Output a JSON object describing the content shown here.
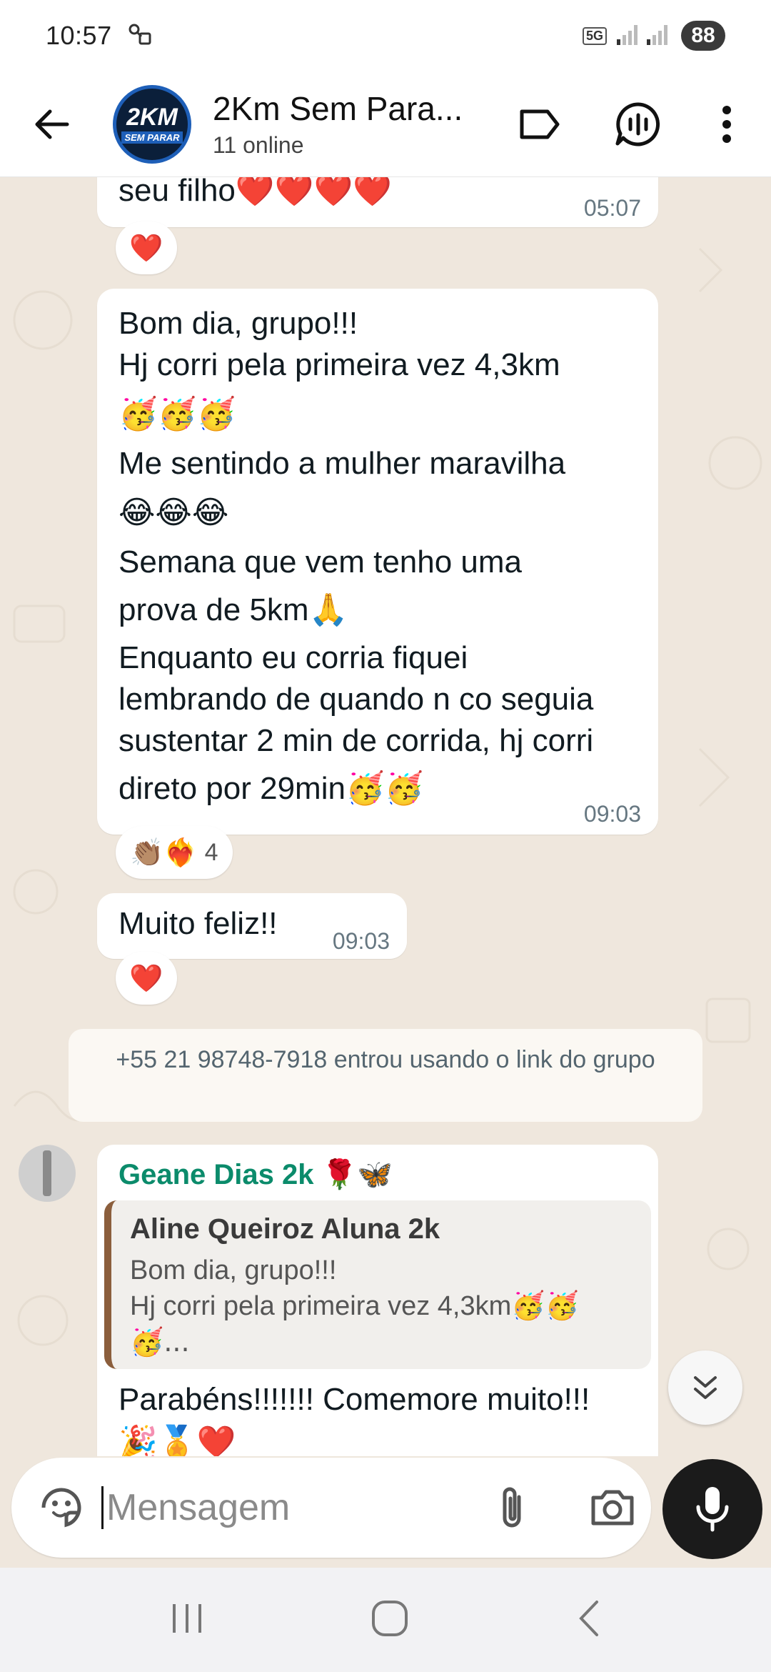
{
  "status_bar": {
    "time": "10:57",
    "network": "5G",
    "battery": "88"
  },
  "header": {
    "avatar_line1": "2KM",
    "avatar_line2": "SEM PARAR",
    "title": "2Km Sem Para...",
    "subtitle": "11 online"
  },
  "messages": [
    {
      "text": "seu filho❤️❤️❤️❤️",
      "time": "05:07",
      "reaction": "❤️"
    },
    {
      "lines": [
        "Bom dia, grupo!!!",
        "Hj corri pela primeira vez 4,3km",
        "🥳🥳🥳",
        "Me sentindo a mulher maravilha",
        "😂😂😂",
        "Semana que vem tenho uma",
        "prova de 5km🙏",
        "Enquanto eu corria fiquei",
        "lembrando de quando n co seguia",
        "sustentar 2 min de corrida, hj corri",
        "direto por 29min🥳🥳"
      ],
      "time": "09:03",
      "reactions": "👏🏽❤️‍🔥",
      "reaction_count": "4"
    },
    {
      "text": "Muito feliz!!",
      "time": "09:03",
      "reaction": "❤️"
    }
  ],
  "system_message": "+55 21 98748-7918 entrou usando o link do grupo",
  "reply_message": {
    "sender": "Geane Dias 2k 🌹🦋",
    "quoted_name": "Aline Queiroz Aluna 2k",
    "quoted_line1": "Bom dia, grupo!!!",
    "quoted_line2": "Hj corri pela primeira vez 4,3km🥳🥳",
    "quoted_line3": "🥳...",
    "text": "Parabéns!!!!!!! Comemore muito!!!",
    "emojis": "🎉🏅❤️"
  },
  "input": {
    "placeholder": "Mensagem"
  },
  "colors": {
    "accent": "#0b8b6b",
    "chat_bg": "#efe7dd",
    "bubble": "#ffffff",
    "mic_button": "#1b1b1b"
  },
  "icons": {
    "back": "arrow-left-icon",
    "label": "label-icon",
    "voice_chat": "voice-chat-icon",
    "menu": "more-vertical-icon",
    "sticker": "sticker-icon",
    "attach": "paperclip-icon",
    "camera": "camera-icon",
    "mic": "microphone-icon",
    "scroll_down": "double-chevron-down-icon"
  }
}
